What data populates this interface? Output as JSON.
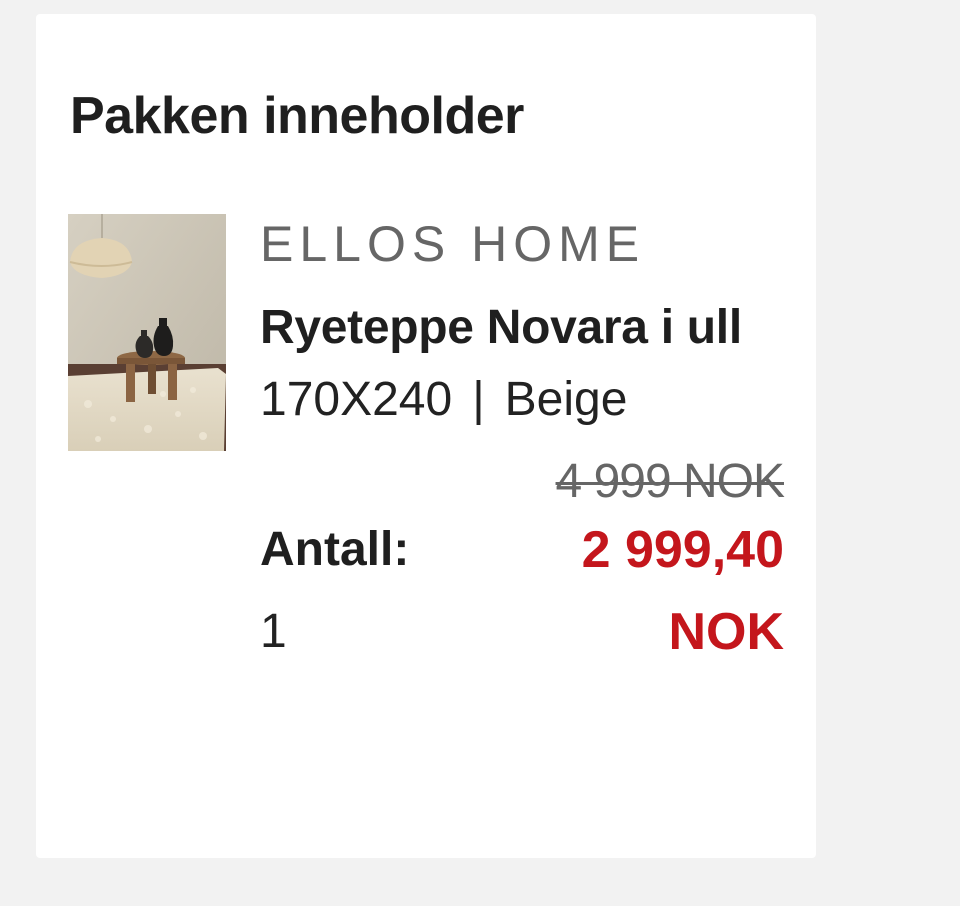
{
  "section": {
    "title": "Pakken inneholder"
  },
  "product": {
    "image_alt": "Ryeteppe Novara i ull",
    "brand": "ELLOS HOME",
    "name": "Ryeteppe Novara i ull",
    "size": "170X240",
    "separator": "|",
    "color": "Beige",
    "old_price": "4 999 NOK",
    "new_price": "2 999,40 NOK",
    "quantity_label": "Antall:",
    "quantity_value": "1"
  },
  "colors": {
    "sale_price": "#c4161c",
    "brand_text": "#666666",
    "page_background": "#f2f2f2",
    "card_background": "#ffffff"
  }
}
